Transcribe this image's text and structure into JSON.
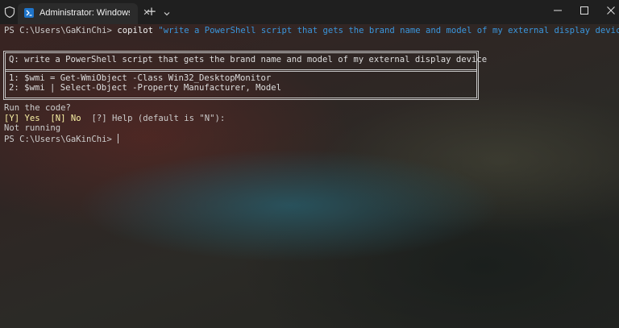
{
  "titlebar": {
    "tab_title": "Administrator: Windows PowerShell",
    "tab_close": "✕",
    "new_tab": "+"
  },
  "terminal": {
    "prompt1": "PS C:\\Users\\GaKinChi> ",
    "command": "copilot",
    "argument": "\"write a PowerShell script that gets the brand name and model of my external display device\"",
    "question": "Q: write a PowerShell script that gets the brand name and model of my external display device",
    "code_lines": [
      "1: $wmi = Get-WmiObject -Class Win32_DesktopMonitor",
      "2: $wmi | Select-Object -Property Manufacturer, Model"
    ],
    "run_prompt": "Run the code?",
    "options": {
      "yes": "[Y] Yes",
      "no": "[N] No",
      "rest": "  [?] Help (default is \"N\"):"
    },
    "result": "Not running",
    "prompt2": "PS C:\\Users\\GaKinChi> "
  },
  "colors": {
    "string": "#3a96dd",
    "option_highlight": "#f9f1a5",
    "text": "#cccccc"
  },
  "icons": [
    "shield-icon",
    "powershell-icon",
    "close-icon",
    "plus-icon",
    "chevron-down-icon",
    "minimize-icon",
    "maximize-icon",
    "window-close-icon"
  ]
}
